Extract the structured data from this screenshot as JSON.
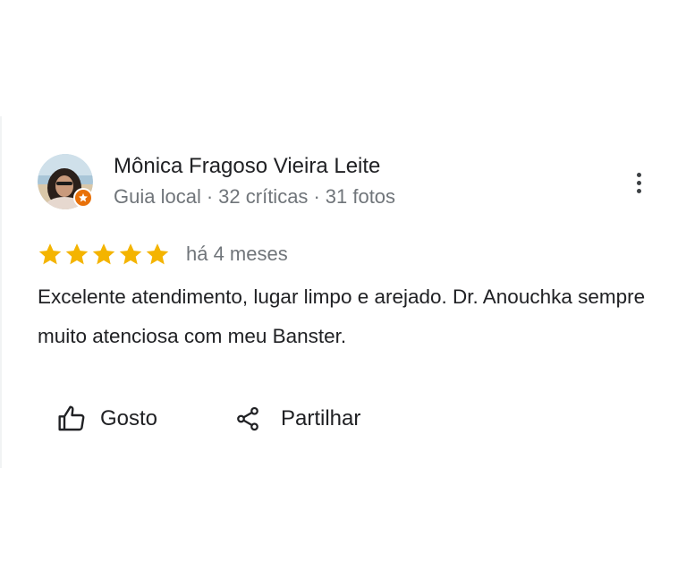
{
  "review": {
    "author": {
      "name": "Mônica Fragoso Vieira Leite",
      "local_guide": "Guia local",
      "reviews_count": "32 críticas",
      "photos_count": "31 fotos",
      "separator": "·"
    },
    "rating": {
      "stars": 5,
      "max_stars": 5,
      "star_color": "#f4b400"
    },
    "time": "há 4 meses",
    "text": "Excelente atendimento, lugar limpo e arejado. Dr. Anouchka sempre muito atenciosa com meu Banster.",
    "actions": {
      "like_label": "Gosto",
      "share_label": "Partilhar"
    },
    "icons": {
      "more": "more-vert-icon",
      "like": "thumb-up-icon",
      "share": "share-icon",
      "badge": "local-guide-star-icon"
    }
  }
}
